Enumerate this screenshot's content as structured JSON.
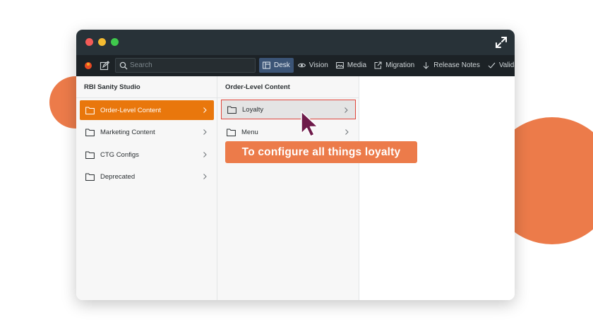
{
  "toolbar": {
    "search_placeholder": "Search",
    "tools": [
      {
        "label": "Desk",
        "icon": "desk-icon",
        "active": true
      },
      {
        "label": "Vision",
        "icon": "eye-icon",
        "active": false
      },
      {
        "label": "Media",
        "icon": "image-icon",
        "active": false
      },
      {
        "label": "Migration",
        "icon": "external-link-icon",
        "active": false
      },
      {
        "label": "Release Notes",
        "icon": "arrow-down-icon",
        "active": false
      },
      {
        "label": "Validatio",
        "icon": "checkmark-icon",
        "active": false
      }
    ]
  },
  "pane1": {
    "title": "RBI Sanity Studio",
    "items": [
      {
        "label": "Order-Level Content",
        "selected": true
      },
      {
        "label": "Marketing Content",
        "selected": false
      },
      {
        "label": "CTG Configs",
        "selected": false
      },
      {
        "label": "Deprecated",
        "selected": false
      }
    ]
  },
  "pane2": {
    "title": "Order-Level Content",
    "items": [
      {
        "label": "Loyalty",
        "highlighted": true
      },
      {
        "label": "Menu",
        "highlighted": false
      }
    ]
  },
  "tooltip": {
    "text": "To configure all things loyalty"
  },
  "colors": {
    "accent_orange": "#e9770c",
    "decor_orange": "#ec7b4a",
    "titlebar": "#283238",
    "toolbar": "#1c2226",
    "active_tool": "#3b5476",
    "highlight_border": "#e0443a",
    "cursor": "#6e1a4a"
  }
}
